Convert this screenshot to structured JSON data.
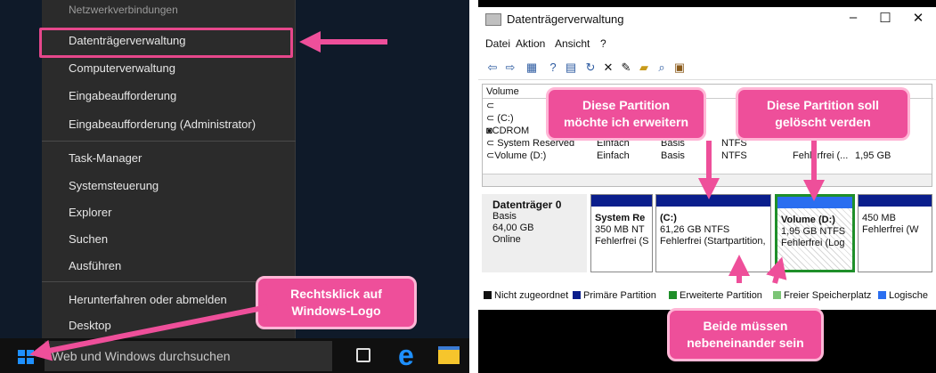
{
  "left": {
    "menu_items": [
      "Netzwerkverbindungen",
      "Datenträgerverwaltung",
      "Computerverwaltung",
      "Eingabeaufforderung",
      "Eingabeaufforderung (Administrator)",
      "Task-Manager",
      "Systemsteuerung",
      "Explorer",
      "Suchen",
      "Ausführen",
      "Herunterfahren oder abmelden",
      "Desktop"
    ],
    "search_placeholder": "Web und Windows durchsuchen",
    "callout_start": "Rechtsklick auf\nWindows-Logo"
  },
  "right": {
    "window_title": "Datenträgerverwaltung",
    "menu": [
      "Datei",
      "Aktion",
      "Ansicht",
      "?"
    ],
    "table_header": {
      "volume": "Volume",
      "layout": "",
      "type": "",
      "fs": "",
      "status": "",
      "cap": ""
    },
    "volumes": [
      {
        "name": "",
        "layout": "",
        "type": "",
        "fs": "",
        "status": "",
        "cap": ""
      },
      {
        "name": "(C:)",
        "layout": "",
        "type": "",
        "fs": "",
        "status": "",
        "cap": ""
      },
      {
        "name": "CDROM",
        "layout": "",
        "type": "",
        "fs": "",
        "status": "",
        "cap": ""
      },
      {
        "name": "System Reserved",
        "layout": "Einfach",
        "type": "Basis",
        "fs": "NTFS",
        "status": "",
        "cap": ""
      },
      {
        "name": "Volume (D:)",
        "layout": "Einfach",
        "type": "Basis",
        "fs": "NTFS",
        "status": "Fehlerfrei (...",
        "cap": "1,95 GB"
      }
    ],
    "disk": {
      "name": "Datenträger 0",
      "type": "Basis",
      "size": "64,00 GB",
      "state": "Online"
    },
    "partitions": [
      {
        "name": "System Re",
        "size": "350 MB NT",
        "status": "Fehlerfrei (S"
      },
      {
        "name": "(C:)",
        "size": "61,26 GB NTFS",
        "status": "Fehlerfrei (Startpartition,"
      },
      {
        "name": "Volume  (D:)",
        "size": "1,95 GB NTFS",
        "status": "Fehlerfrei (Log"
      },
      {
        "name": "",
        "size": "450 MB",
        "status": "Fehlerfrei (W"
      }
    ],
    "legend": [
      {
        "label": "Nicht zugeordnet",
        "color": "#111111"
      },
      {
        "label": "Primäre Partition",
        "color": "#0a1e8c"
      },
      {
        "label": "Erweiterte Partition",
        "color": "#1f8f2a"
      },
      {
        "label": "Freier Speicherplatz",
        "color": "#7cc576"
      },
      {
        "label": "Logische",
        "color": "#2a6ef0"
      }
    ],
    "callout_extend": "Diese Partition\nmöchte ich erweitern",
    "callout_delete": "Diese Partition soll\ngelöscht verden",
    "callout_adjacent": "Beide müssen\nnebeneinander sein"
  },
  "colors": {
    "accent_pink": "#ee4f9a",
    "win_blue": "#1e90ff"
  }
}
